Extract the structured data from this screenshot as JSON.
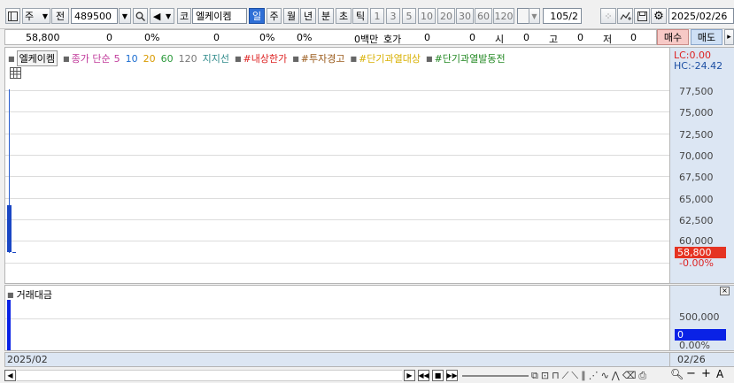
{
  "toolbar": {
    "market_label": "주",
    "prev_label": "전",
    "code_value": "489500",
    "market_badge": "코",
    "stock_name": "엘케이켐",
    "periods": [
      "일",
      "주",
      "월",
      "년",
      "분",
      "초",
      "틱"
    ],
    "minute_steps": [
      "1",
      "3",
      "5",
      "10",
      "20",
      "30",
      "60",
      "120"
    ],
    "count_value": "105",
    "count_suffix": "/2",
    "date_value": "2025/02/26"
  },
  "quote": {
    "price": "58,800",
    "change": "0",
    "change_pct": "0%",
    "volume": "0",
    "vol_pct": "0%",
    "turnover_pct": "0%",
    "amount_unit": "0백만",
    "hoga_label": "호가",
    "hoga_value": "0",
    "hoga_value2": "0",
    "open_label": "시",
    "open_value": "0",
    "high_label": "고",
    "high_value": "0",
    "low_label": "저",
    "low_value": "0",
    "buy_label": "매수",
    "sell_label": "매도"
  },
  "legend": {
    "stock": "엘케이켐",
    "ma_label": "종가 단순",
    "ma_5": "5",
    "ma_10": "10",
    "ma_20": "20",
    "ma_60": "60",
    "ma_120": "120",
    "support": "지지선",
    "limit": "#내상한가",
    "warning": "#투자경고",
    "overheat": "#단기과열대상",
    "overheat_trigger": "#단기과열발동전"
  },
  "price_axis": {
    "lc": "LC:0.00",
    "hc": "HC:-24.42",
    "ticks": [
      "77,500",
      "75,000",
      "72,500",
      "70,000",
      "67,500",
      "65,000",
      "62,500",
      "60,000"
    ],
    "current_price": "58,800",
    "current_pct": "-0.00%"
  },
  "volume_pane": {
    "title": "거래대금",
    "tick": "500,000",
    "current": "0",
    "current_pct": "0.00%"
  },
  "footer": {
    "date_left": "2025/02",
    "date_right": "02/26"
  },
  "colors": {
    "bar_blue": "#1240c8",
    "price_badge": "#e53322",
    "volume_badge": "#0a22e6",
    "axis_bg": "#dce6f3"
  }
}
